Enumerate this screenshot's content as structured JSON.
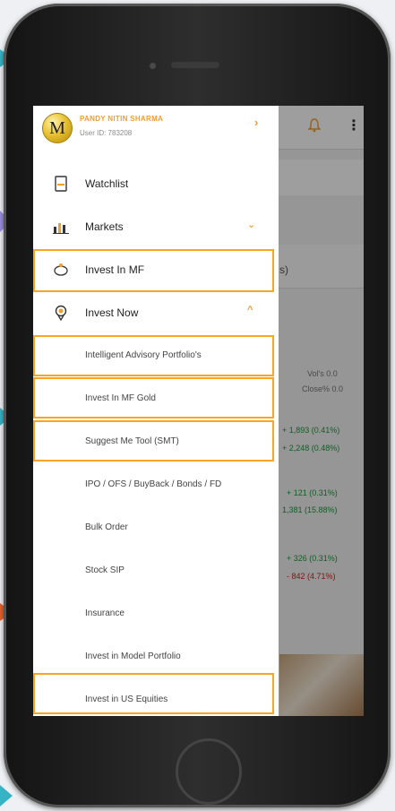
{
  "user": {
    "avatar_letter": "M",
    "name": "PANDY NITIN SHARMA",
    "id": "User ID: 783208"
  },
  "drawer": {
    "head_chevron": "›",
    "items": [
      {
        "label": "Watchlist",
        "icon": "watchlist-icon"
      },
      {
        "label": "Markets",
        "icon": "markets-icon",
        "chevron": "⌄"
      },
      {
        "label": "Invest In MF",
        "icon": "piggy-bank-icon"
      },
      {
        "label": "Invest Now",
        "icon": "invest-now-icon",
        "chevron": "^"
      }
    ],
    "subitems": [
      "Intelligent Advisory Portfolio's",
      "Invest In MF Gold",
      "Suggest Me Tool (SMT)",
      "IPO / OFS / BuyBack / Bonds / FD",
      "Bulk Order",
      "Stock SIP",
      "Insurance",
      "Invest in Model Portfolio",
      "Invest in US Equities"
    ]
  },
  "background_app": {
    "paren": "s)",
    "header_label_1": "Vol's 0.0",
    "header_label_2": "Close% 0.0",
    "rows": [
      {
        "text": "+ 1,893 (0.41%)",
        "tone": "gain"
      },
      {
        "text": "+ 2,248 (0.48%)",
        "tone": "gain"
      },
      {
        "text": "+ 121 (0.31%)",
        "tone": "gain"
      },
      {
        "text": "1,381 (15.88%)",
        "tone": "gain"
      },
      {
        "text": "+ 326 (0.31%)",
        "tone": "gain"
      },
      {
        "text": "- 842 (4.71%)",
        "tone": "loss"
      }
    ]
  },
  "colors": {
    "accent": "#f6a623",
    "gain": "#1a9a3a",
    "loss": "#d21f1f"
  }
}
